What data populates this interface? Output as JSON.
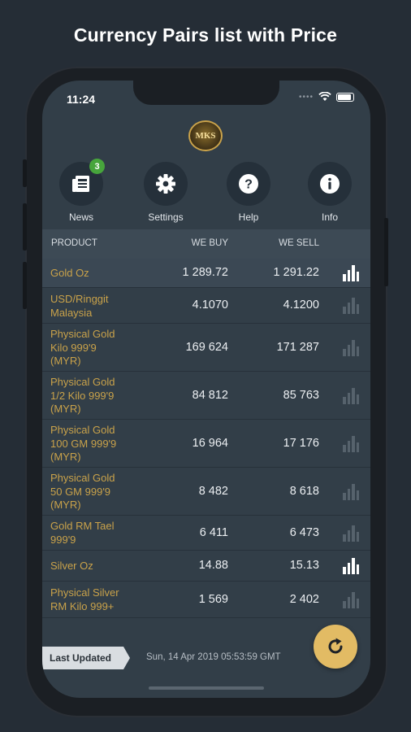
{
  "headline": "Currency Pairs list with Price",
  "status": {
    "time": "11:24"
  },
  "logo_text": "MKS",
  "nav": [
    {
      "label": "News",
      "icon": "news-icon",
      "badge": "3"
    },
    {
      "label": "Settings",
      "icon": "gear-icon"
    },
    {
      "label": "Help",
      "icon": "help-icon"
    },
    {
      "label": "Info",
      "icon": "info-icon"
    }
  ],
  "table": {
    "headers": {
      "product": "PRODUCT",
      "buy": "WE BUY",
      "sell": "WE SELL"
    },
    "rows": [
      {
        "product": "Gold Oz",
        "buy": "1 289.72",
        "sell": "1 291.22",
        "chart_active": true
      },
      {
        "product": "USD/Ringgit\nMalaysia",
        "buy": "4.1070",
        "sell": "4.1200",
        "chart_active": false
      },
      {
        "product": "Physical Gold\nKilo 999'9\n(MYR)",
        "buy": "169 624",
        "sell": "171 287",
        "chart_active": false
      },
      {
        "product": "Physical Gold\n1/2 Kilo 999'9\n(MYR)",
        "buy": "84 812",
        "sell": "85 763",
        "chart_active": false
      },
      {
        "product": "Physical Gold\n100 GM 999'9\n(MYR)",
        "buy": "16 964",
        "sell": "17 176",
        "chart_active": false
      },
      {
        "product": "Physical Gold\n50 GM 999'9\n(MYR)",
        "buy": "8 482",
        "sell": "8 618",
        "chart_active": false
      },
      {
        "product": "Gold RM Tael\n999'9",
        "buy": "6 411",
        "sell": "6 473",
        "chart_active": false
      },
      {
        "product": "Silver Oz",
        "buy": "14.88",
        "sell": "15.13",
        "chart_active": true
      },
      {
        "product": "Physical Silver\nRM Kilo 999+",
        "buy": "1 569",
        "sell": "2 402",
        "chart_active": false
      }
    ]
  },
  "footer": {
    "last_updated_label": "Last Updated",
    "last_updated_value": "Sun, 14 Apr 2019 05:53:59 GMT"
  },
  "colors": {
    "background": "#252d36",
    "screen": "#323e48",
    "gold_text": "#c9a24a",
    "refresh_button": "#e2bb64",
    "badge": "#47a53c"
  }
}
